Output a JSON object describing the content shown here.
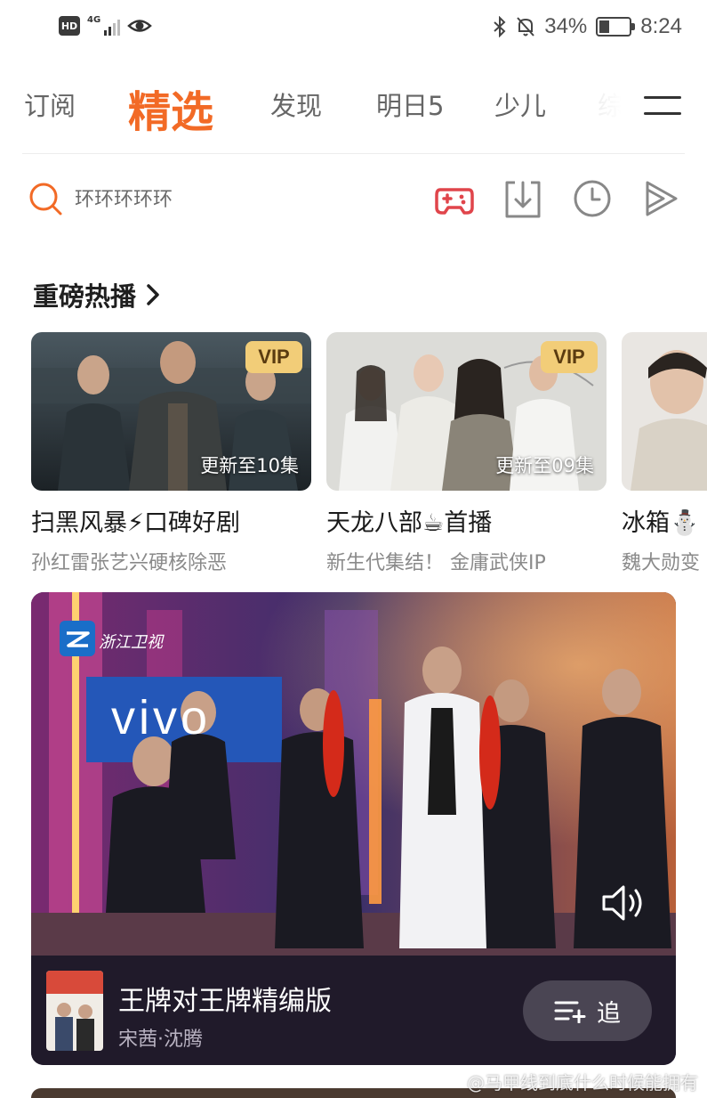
{
  "status_bar": {
    "hd_label": "HD",
    "network": "4G",
    "battery_text": "34%",
    "battery_level": 0.34,
    "time": "8:24"
  },
  "tabs": [
    {
      "label": "订阅",
      "active": false
    },
    {
      "label": "精选",
      "active": true
    },
    {
      "label": "发现",
      "active": false
    },
    {
      "label": "明日5",
      "active": false
    },
    {
      "label": "少儿",
      "active": false
    },
    {
      "label": "综",
      "active": false
    }
  ],
  "search": {
    "placeholder": "环环环环环",
    "tool_icons": [
      "gamepad-icon",
      "download-icon",
      "history-icon",
      "play-icon"
    ]
  },
  "section": {
    "title": "重磅热播"
  },
  "cards": [
    {
      "badge": "VIP",
      "episode": "更新至10集",
      "title": "扫黑风暴⚡口碑好剧",
      "subtitle": "孙红雷张艺兴硬核除恶"
    },
    {
      "badge": "VIP",
      "episode": "更新至09集",
      "title": "天龙八部☕首播",
      "subtitle": "新生代集结！ 金庸武侠IP"
    },
    {
      "badge": "",
      "episode": "",
      "title": "冰箱⛄",
      "subtitle": "魏大勋变"
    }
  ],
  "hero": {
    "channel_logo": "浙江卫视",
    "sponsor_logo": "vivo",
    "title": "王牌对王牌精编版",
    "subtitle": "宋茜·沈腾",
    "follow_label": "追"
  },
  "watermark": "@马甲线到底什么时候能拥有",
  "colors": {
    "accent": "#f26a26",
    "vip_gold": "#f2cd78",
    "game_icon": "#e0454b",
    "hero_bar": "#201a2a"
  }
}
